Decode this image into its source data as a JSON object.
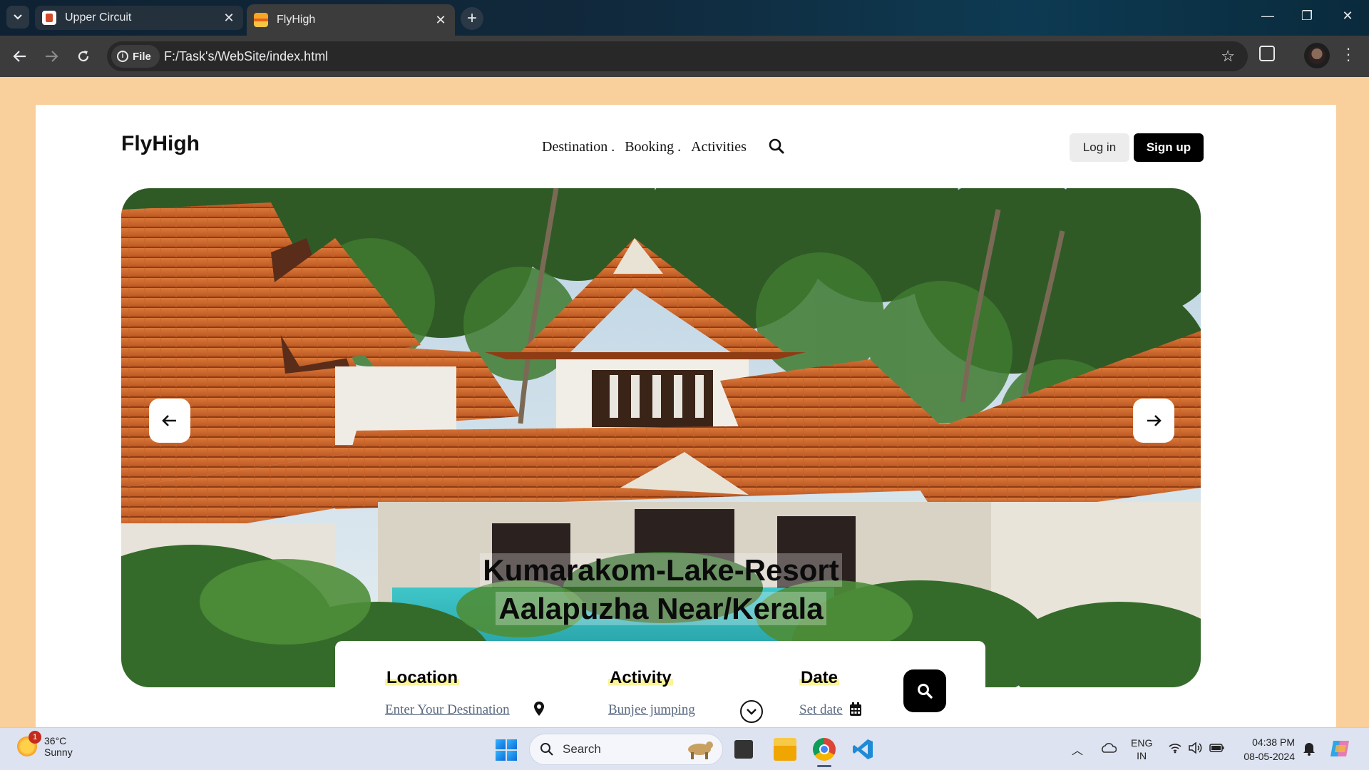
{
  "browser": {
    "tabs": [
      {
        "title": "Upper Circuit",
        "active": false
      },
      {
        "title": "FlyHigh",
        "active": true
      }
    ],
    "new_tab": "+",
    "chip_label": "File",
    "url": "F:/Task's/WebSite/index.html"
  },
  "site": {
    "logo": "FlyHigh",
    "nav": [
      {
        "label": "Destination ."
      },
      {
        "label": "Booking ."
      },
      {
        "label": "Activities"
      }
    ],
    "login": "Log in",
    "signup": "Sign up",
    "hero": {
      "line1": "Kumarakom-Lake-Resort",
      "line2": "Aalapuzha Near/Kerala",
      "prev_icon": "arrow-left-icon",
      "next_icon": "arrow-right-icon"
    },
    "search": {
      "location_label": "Location",
      "location_placeholder": "Enter Your Destination",
      "activity_label": "Activity",
      "activity_value": "Bunjee jumping",
      "date_label": "Date",
      "date_placeholder": "Set date"
    }
  },
  "taskbar": {
    "weather_temp": "36°C",
    "weather_desc": "Sunny",
    "weather_badge": "1",
    "search_label": "Search",
    "lang_line1": "ENG",
    "lang_line2": "IN",
    "time": "04:38 PM",
    "date": "08-05-2024"
  },
  "colors": {
    "page_background": "#f9cf9c",
    "signup_bg": "#000000",
    "highlight": "#fbf49a"
  }
}
